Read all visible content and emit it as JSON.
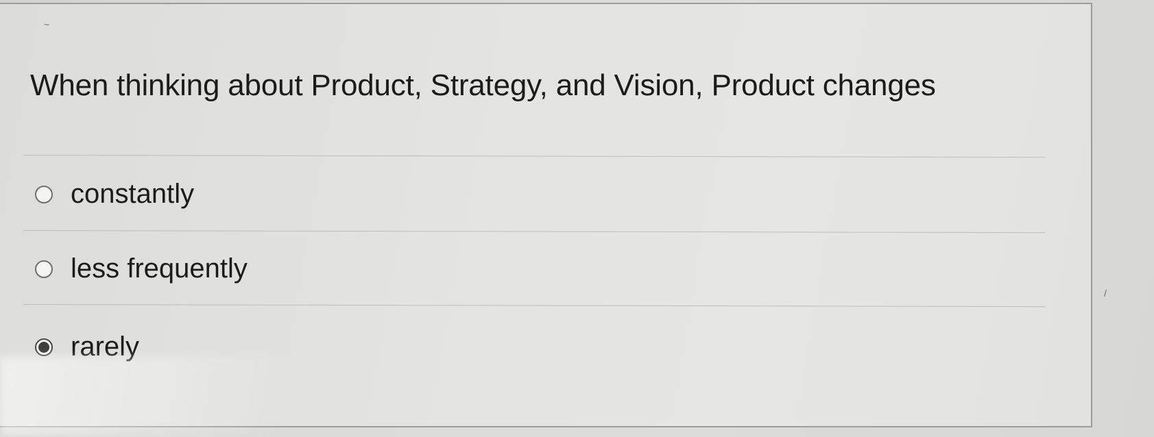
{
  "question": {
    "text": "When thinking about Product, Strategy, and Vision, Product changes"
  },
  "options": [
    {
      "label": "constantly",
      "selected": false
    },
    {
      "label": "less frequently",
      "selected": false
    },
    {
      "label": "rarely",
      "selected": true
    }
  ],
  "colors": {
    "panel_background": "#e4e4e2",
    "page_background": "#d8d8d6",
    "text": "#1c1c1c",
    "divider": "#bdbdbb",
    "radio_selected": "#3e3e3e"
  }
}
